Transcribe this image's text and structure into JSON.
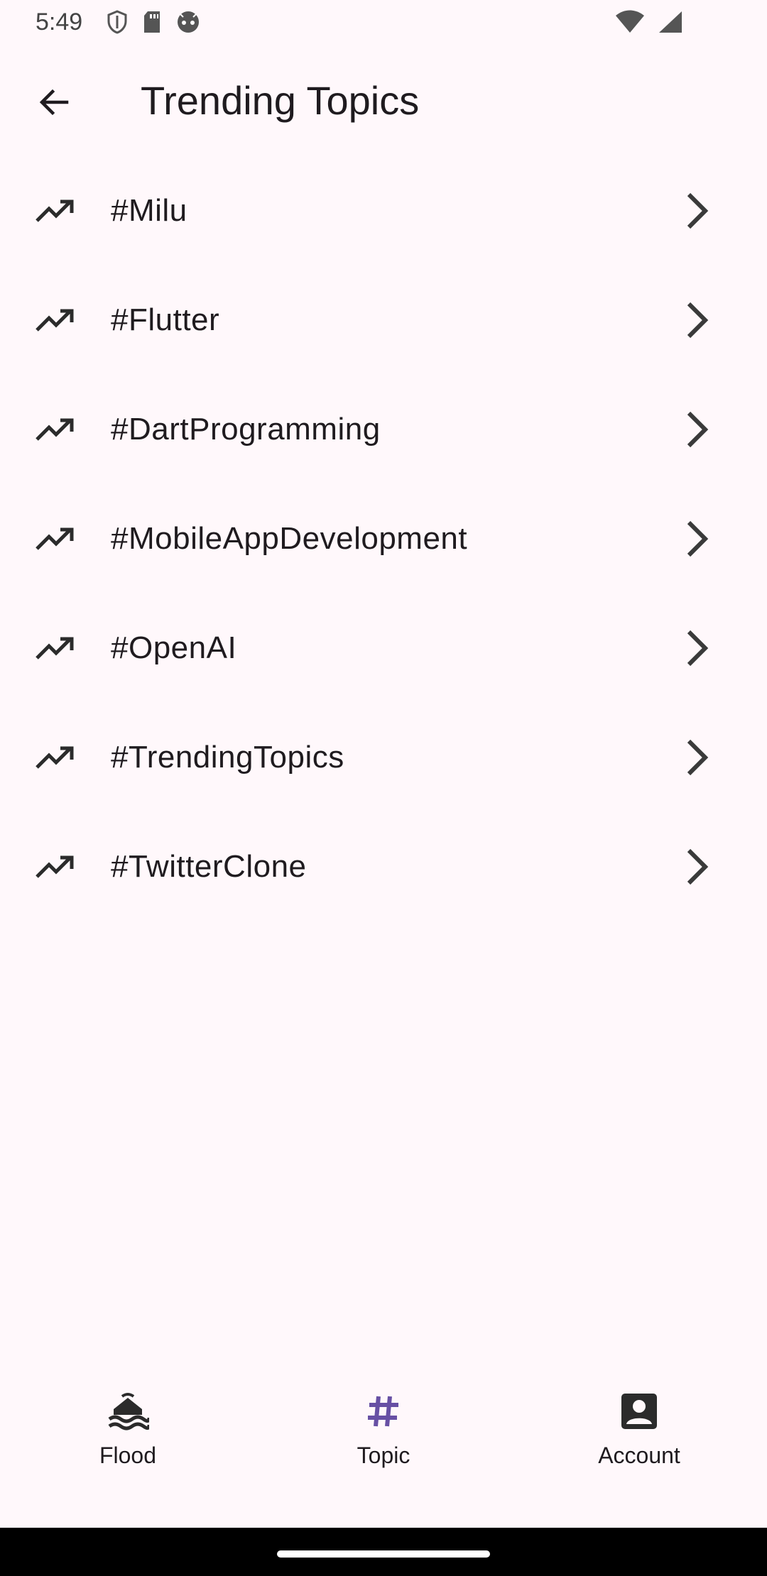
{
  "status_bar": {
    "time": "5:49"
  },
  "app_bar": {
    "title": "Trending Topics",
    "back_icon": "arrow-back-icon"
  },
  "topics": [
    {
      "label": "#Milu"
    },
    {
      "label": "#Flutter"
    },
    {
      "label": "#DartProgramming"
    },
    {
      "label": "#MobileAppDevelopment"
    },
    {
      "label": "#OpenAI"
    },
    {
      "label": "#TrendingTopics"
    },
    {
      "label": "#TwitterClone"
    }
  ],
  "bottom_nav": {
    "items": [
      {
        "label": "Flood",
        "icon": "flood-icon",
        "active": false
      },
      {
        "label": "Topic",
        "icon": "hashtag-icon",
        "active": true
      },
      {
        "label": "Account",
        "icon": "account-box-icon",
        "active": false
      }
    ]
  },
  "colors": {
    "background": "#FFF8FB",
    "text": "#1F1B1F",
    "icon": "#2B2B2B",
    "accent": "#6750A4",
    "gesture_bar": "#000000"
  }
}
